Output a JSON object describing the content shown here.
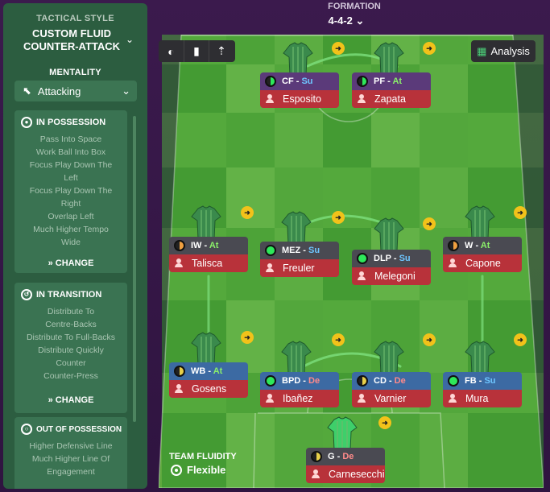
{
  "sidebar": {
    "tactical_style_label": "TACTICAL STYLE",
    "style_name_line1": "CUSTOM FLUID",
    "style_name_line2": "COUNTER-ATTACK",
    "mentality_label": "MENTALITY",
    "mentality_value": "Attacking",
    "in_possession": {
      "title": "IN POSSESSION",
      "items": [
        "Pass Into Space",
        "Work Ball Into Box",
        "Focus Play Down The",
        "Left",
        "Focus Play Down The",
        "Right",
        "Overlap Left",
        "Much Higher Tempo",
        "Wide"
      ],
      "change_label": "CHANGE"
    },
    "in_transition": {
      "title": "IN TRANSITION",
      "items": [
        "Distribute To",
        "Centre-Backs",
        "Distribute To Full-Backs",
        "Distribute Quickly",
        "Counter",
        "Counter-Press"
      ],
      "change_label": "CHANGE"
    },
    "out_of_possession": {
      "title": "OUT OF POSSESSION",
      "items": [
        "Higher Defensive Line",
        "Much Higher Line Of",
        "Engagement"
      ]
    }
  },
  "header": {
    "formation_label": "FORMATION",
    "formation_value": "4-4-2"
  },
  "toolbar": {
    "analysis_label": "Analysis"
  },
  "team_fluidity": {
    "label": "TEAM FLUIDITY",
    "value": "Flexible"
  },
  "players": [
    {
      "role": "CF",
      "duty": "Su",
      "name": "Esposito",
      "top_color": "purple",
      "dot": "half-g"
    },
    {
      "role": "PF",
      "duty": "At",
      "name": "Zapata",
      "top_color": "purple",
      "dot": "half-g"
    },
    {
      "role": "IW",
      "duty": "At",
      "name": "Talisca",
      "top_color": "grey",
      "dot": "half-o"
    },
    {
      "role": "MEZ",
      "duty": "Su",
      "name": "Freuler",
      "top_color": "grey",
      "dot": "green"
    },
    {
      "role": "DLP",
      "duty": "Su",
      "name": "Melegoni",
      "top_color": "grey",
      "dot": "green"
    },
    {
      "role": "W",
      "duty": "At",
      "name": "Capone",
      "top_color": "grey",
      "dot": "half-o"
    },
    {
      "role": "WB",
      "duty": "At",
      "name": "Gosens",
      "top_color": "blue",
      "dot": "half-y"
    },
    {
      "role": "BPD",
      "duty": "De",
      "name": "Ibañez",
      "top_color": "blue",
      "dot": "green"
    },
    {
      "role": "CD",
      "duty": "De",
      "name": "Varnier",
      "top_color": "blue",
      "dot": "half-y"
    },
    {
      "role": "FB",
      "duty": "Su",
      "name": "Mura",
      "top_color": "blue",
      "dot": "green"
    },
    {
      "role": "G",
      "duty": "De",
      "name": "Carnesecchi",
      "top_color": "grey",
      "dot": "half-y"
    }
  ],
  "colors": {
    "sidebar_bg": "#2c5d40",
    "role_attack": "#5b3a7a",
    "role_mid": "#4a4a52",
    "role_def": "#3c6aa3",
    "name_bar": "#b8323a",
    "badge": "#f2c21a"
  }
}
